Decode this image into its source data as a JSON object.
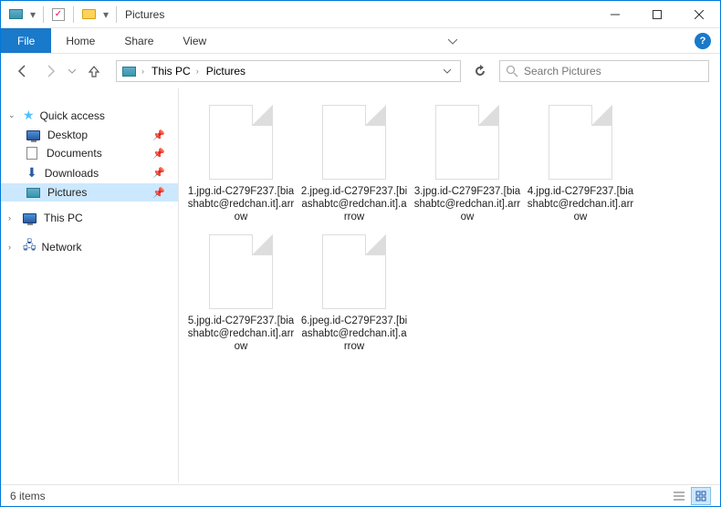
{
  "titlebar": {
    "title": "Pictures"
  },
  "ribbon": {
    "file": "File",
    "tabs": [
      "Home",
      "Share",
      "View"
    ]
  },
  "breadcrumb": {
    "segments": [
      "This PC",
      "Pictures"
    ]
  },
  "search": {
    "placeholder": "Search Pictures"
  },
  "sidebar": {
    "quick_access": "Quick access",
    "items": [
      {
        "label": "Desktop",
        "icon": "monitor"
      },
      {
        "label": "Documents",
        "icon": "doc"
      },
      {
        "label": "Downloads",
        "icon": "down"
      },
      {
        "label": "Pictures",
        "icon": "pic",
        "active": true
      }
    ],
    "this_pc": "This PC",
    "network": "Network"
  },
  "files": [
    {
      "name": "1.jpg.id-C279F237.[biashabtc@redchan.it].arrow"
    },
    {
      "name": "2.jpeg.id-C279F237.[biashabtc@redchan.it].arrow"
    },
    {
      "name": "3.jpg.id-C279F237.[biashabtc@redchan.it].arrow"
    },
    {
      "name": "4.jpg.id-C279F237.[biashabtc@redchan.it].arrow"
    },
    {
      "name": "5.jpg.id-C279F237.[biashabtc@redchan.it].arrow"
    },
    {
      "name": "6.jpeg.id-C279F237.[biashabtc@redchan.it].arrow"
    }
  ],
  "statusbar": {
    "count": "6 items"
  }
}
